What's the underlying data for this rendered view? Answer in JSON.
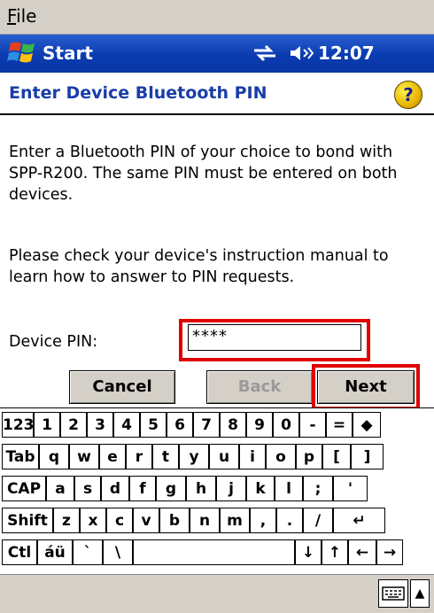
{
  "menu": {
    "file": "File"
  },
  "taskbar": {
    "start": "Start",
    "time": "12:07",
    "icons": [
      "windows-flag-icon",
      "connectivity-icon",
      "speaker-icon"
    ]
  },
  "title": "Enter Device Bluetooth PIN",
  "help_label": "?",
  "content": {
    "para1": "Enter a Bluetooth PIN of your choice to bond with SPP-R200. The same PIN must be entered on both devices.",
    "para2": "Please check your device's instruction manual to learn how to answer to PIN requests.",
    "pin_label": "Device PIN:",
    "pin_value": "****"
  },
  "buttons": {
    "cancel": "Cancel",
    "back": "Back",
    "next": "Next"
  },
  "keyboard": {
    "row1": [
      "123",
      "1",
      "2",
      "3",
      "4",
      "5",
      "6",
      "7",
      "8",
      "9",
      "0",
      "-",
      "=",
      "◆"
    ],
    "row2": [
      "Tab",
      "q",
      "w",
      "e",
      "r",
      "t",
      "y",
      "u",
      "i",
      "o",
      "p",
      "[",
      "]"
    ],
    "row3": [
      "CAP",
      "a",
      "s",
      "d",
      "f",
      "g",
      "h",
      "j",
      "k",
      "l",
      ";",
      "'"
    ],
    "row4": [
      "Shift",
      "z",
      "x",
      "c",
      "v",
      "b",
      "n",
      "m",
      ",",
      ".",
      "/",
      "↵"
    ],
    "row5": [
      "Ctl",
      "áü",
      "`",
      "\\",
      "",
      "↓",
      "↑",
      "←",
      "→"
    ]
  },
  "colors": {
    "taskbar": "#0a3bb0",
    "title": "#1a3ea8",
    "highlight": "#e00000"
  }
}
